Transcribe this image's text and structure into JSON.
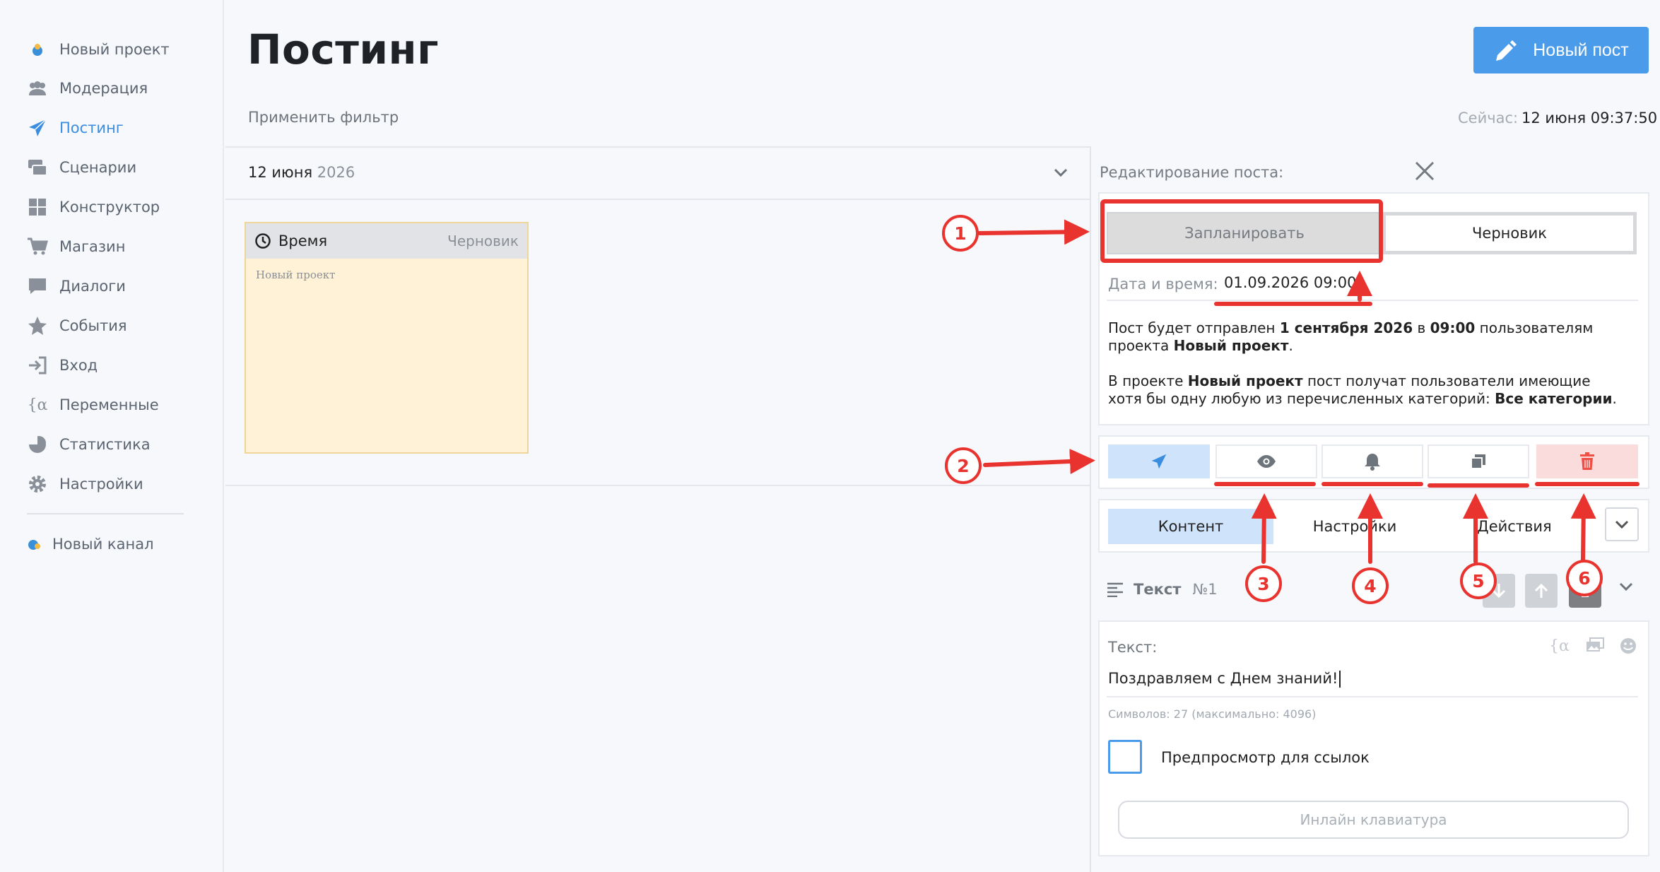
{
  "sidebar": {
    "items": [
      {
        "label": "Новый проект",
        "icon": "project-avatar-icon"
      },
      {
        "label": "Модерация",
        "icon": "users-icon"
      },
      {
        "label": "Постинг",
        "icon": "paper-plane-icon"
      },
      {
        "label": "Сценарии",
        "icon": "scenarios-icon"
      },
      {
        "label": "Конструктор",
        "icon": "grid-icon"
      },
      {
        "label": "Магазин",
        "icon": "cart-icon"
      },
      {
        "label": "Диалоги",
        "icon": "chat-icon"
      },
      {
        "label": "События",
        "icon": "star-icon"
      },
      {
        "label": "Вход",
        "icon": "sign-in-icon"
      },
      {
        "label": "Переменные",
        "icon": "variable-icon"
      },
      {
        "label": "Статистика",
        "icon": "pie-chart-icon"
      },
      {
        "label": "Настройки",
        "icon": "gear-icon"
      }
    ],
    "channel": {
      "label": "Новый канал",
      "icon": "channel-avatar-icon"
    }
  },
  "header": {
    "title": "Постинг",
    "new_post_label": "Новый пост",
    "filter_label": "Применить фильтр",
    "now_label": "Сейчас:",
    "now_value": "12 июня 09:37:50"
  },
  "feed": {
    "date_day": "12 июня",
    "date_year": "2026",
    "post_card": {
      "time_label": "Время",
      "status": "Черновик",
      "project": "Новый проект"
    }
  },
  "editor": {
    "title": "Редактирование поста:",
    "mode_schedule": "Запланировать",
    "mode_draft": "Черновик",
    "datetime_label": "Дата и время:",
    "datetime_value": "01.09.2026 09:00",
    "info1": {
      "p1": "Пост будет отправлен ",
      "date": "1 сентября 2026",
      "p2": " в ",
      "time": "09:00",
      "p3": " пользователям проекта ",
      "project": "Новый проект",
      "p4": "."
    },
    "info2": {
      "p1": "В проекте ",
      "project": "Новый проект",
      "p2": " пост получат пользователи имеющие хотя бы одну любую из перечисленных категорий: ",
      "categories": "Все категории",
      "p3": "."
    },
    "tabs": [
      "Контент",
      "Настройки",
      "Действия"
    ],
    "block_title": "Текст",
    "block_number": "№1",
    "text_label": "Текст:",
    "text_value": "Поздравляем с Днем знаний!",
    "chars_info": "Символов: 27 (максимально: 4096)",
    "preview_label": "Предпросмотр для ссылок",
    "inline_kb_label": "Инлайн клавиатура"
  },
  "annotations": [
    "1",
    "2",
    "3",
    "4",
    "5",
    "6"
  ],
  "colors": {
    "accent": "#4a9bea",
    "annotation_red": "#e8332e",
    "card_bg": "#fff2d6",
    "delete_bg": "#fbdcdc"
  }
}
